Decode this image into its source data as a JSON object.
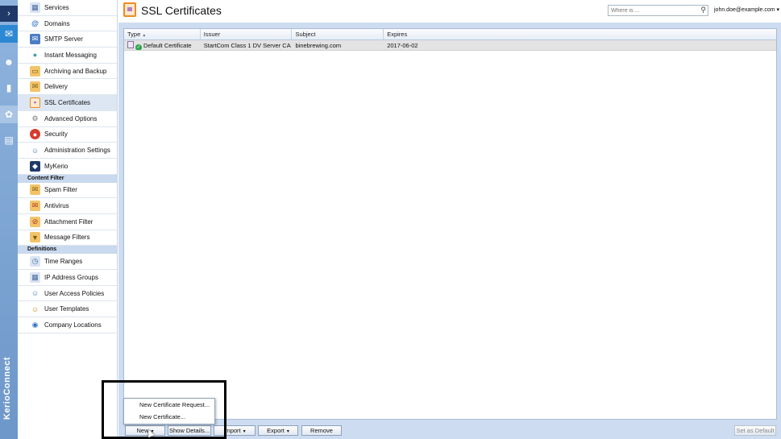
{
  "rail": {
    "items": [
      "expand-icon",
      "mail-icon",
      "people-icon",
      "chart-icon",
      "gear-icon",
      "document-icon"
    ],
    "brand": "KerioConnect"
  },
  "nav": {
    "items": [
      {
        "label": "Services",
        "icon": "services-icon"
      },
      {
        "label": "Domains",
        "icon": "at-icon"
      },
      {
        "label": "SMTP Server",
        "icon": "smtp-icon"
      },
      {
        "label": "Instant Messaging",
        "icon": "chat-icon"
      },
      {
        "label": "Archiving and Backup",
        "icon": "archive-icon"
      },
      {
        "label": "Delivery",
        "icon": "delivery-icon"
      },
      {
        "label": "SSL Certificates",
        "icon": "certificate-icon"
      },
      {
        "label": "Advanced Options",
        "icon": "options-icon"
      },
      {
        "label": "Security",
        "icon": "security-icon"
      },
      {
        "label": "Administration Settings",
        "icon": "admin-icon"
      },
      {
        "label": "MyKerio",
        "icon": "mykerio-icon"
      }
    ],
    "content_filter_header": "Content Filter",
    "content_filter": [
      {
        "label": "Spam Filter",
        "icon": "spam-icon"
      },
      {
        "label": "Antivirus",
        "icon": "antivirus-icon"
      },
      {
        "label": "Attachment Filter",
        "icon": "attachment-icon"
      },
      {
        "label": "Message Filters",
        "icon": "filter-icon"
      }
    ],
    "definitions_header": "Definitions",
    "definitions": [
      {
        "label": "Time Ranges",
        "icon": "time-icon"
      },
      {
        "label": "IP Address Groups",
        "icon": "ip-icon"
      },
      {
        "label": "User Access Policies",
        "icon": "policy-icon"
      },
      {
        "label": "User Templates",
        "icon": "template-icon"
      },
      {
        "label": "Company Locations",
        "icon": "location-icon"
      }
    ]
  },
  "header": {
    "title": "SSL Certificates",
    "search_placeholder": "Where is ...",
    "user": "john.doe@example.com"
  },
  "grid": {
    "columns": [
      "Type",
      "Issuer",
      "Subject",
      "Expires"
    ],
    "sort_indicator": "▲",
    "rows": [
      {
        "type": "Default Certificate",
        "issuer": "StartCom Class 1 DV Server CA",
        "subject": "binebrewing.com",
        "expires": "2017-06-02"
      }
    ]
  },
  "toolbar": {
    "new": "New",
    "show_details": "Show Details...",
    "import": "Import",
    "export": "Export",
    "remove": "Remove",
    "set_as_default": "Set as Default"
  },
  "menu": {
    "items": [
      "New Certificate Request...",
      "New Certificate..."
    ]
  }
}
